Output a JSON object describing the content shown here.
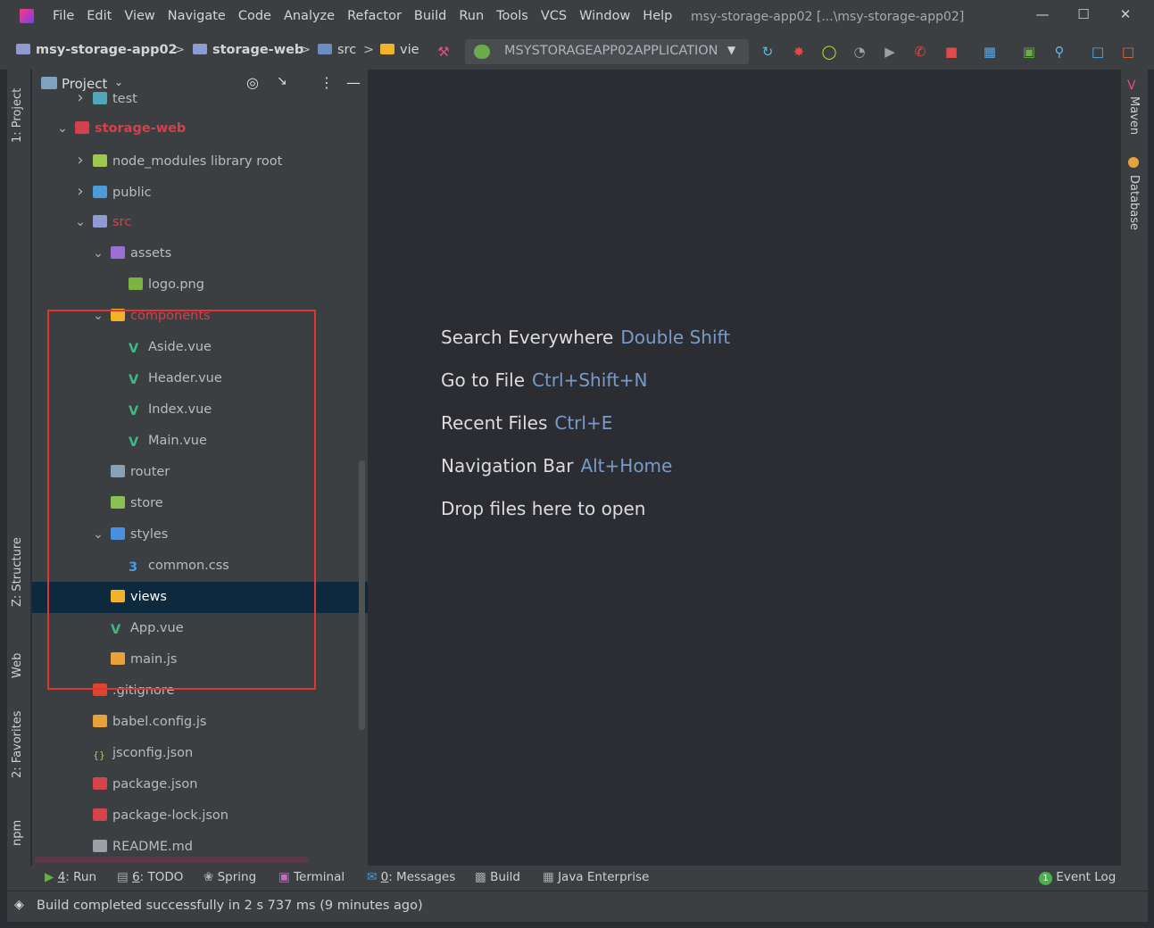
{
  "titlebar": {
    "menu": [
      "File",
      "Edit",
      "View",
      "Navigate",
      "Code",
      "Analyze",
      "Refactor",
      "Build",
      "Run",
      "Tools",
      "VCS",
      "Window",
      "Help"
    ],
    "title": "msy-storage-app02 [...\\msy-storage-app02]"
  },
  "navbar": {
    "crumbs": [
      "msy-storage-app02",
      "storage-web",
      "src",
      "vie"
    ],
    "run_config": "MSYSTORAGEAPP02APPLICATION"
  },
  "left_strip": {
    "tabs": [
      "1: Project",
      "Z: Structure",
      "Web",
      "2: Favorites",
      "npm"
    ]
  },
  "project": {
    "header": "Project",
    "tree": [
      {
        "label": "test",
        "indent": 1,
        "chev": ">",
        "icon": "folder-test",
        "color": "#50a6b8"
      },
      {
        "label": "storage-web",
        "indent": 0,
        "chev": "v",
        "icon": "folder-module",
        "color": "#d3404f",
        "bold": true
      },
      {
        "label": "node_modules  library root",
        "indent": 1,
        "chev": ">",
        "icon": "folder-lib",
        "color": "#9cc850"
      },
      {
        "label": "public",
        "indent": 1,
        "chev": ">",
        "icon": "folder-web",
        "color": "#4a9bd8"
      },
      {
        "label": "src",
        "indent": 1,
        "chev": "v",
        "icon": "folder-src",
        "color": "#8d9bd1",
        "red": true
      },
      {
        "label": "assets",
        "indent": 2,
        "chev": "v",
        "icon": "folder-assets",
        "color": "#9d6fd2"
      },
      {
        "label": "logo.png",
        "indent": 3,
        "chev": "",
        "icon": "image-file",
        "color": "#7cb342"
      },
      {
        "label": "components",
        "indent": 2,
        "chev": "v",
        "icon": "folder-components",
        "color": "#f2b32b",
        "red": true
      },
      {
        "label": "Aside.vue",
        "indent": 3,
        "chev": "",
        "icon": "vue-file",
        "color": "#41b883"
      },
      {
        "label": "Header.vue",
        "indent": 3,
        "chev": "",
        "icon": "vue-file",
        "color": "#41b883"
      },
      {
        "label": "Index.vue",
        "indent": 3,
        "chev": "",
        "icon": "vue-file",
        "color": "#41b883"
      },
      {
        "label": "Main.vue",
        "indent": 3,
        "chev": "",
        "icon": "vue-file",
        "color": "#41b883"
      },
      {
        "label": "router",
        "indent": 2,
        "chev": "",
        "icon": "folder-router",
        "color": "#8aa0b5"
      },
      {
        "label": "store",
        "indent": 2,
        "chev": "",
        "icon": "folder-store",
        "color": "#8cc04f"
      },
      {
        "label": "styles",
        "indent": 2,
        "chev": "v",
        "icon": "folder-styles",
        "color": "#4b8fe0"
      },
      {
        "label": "common.css",
        "indent": 3,
        "chev": "",
        "icon": "css-file",
        "color": "#4b9be8"
      },
      {
        "label": "views",
        "indent": 2,
        "chev": "",
        "icon": "folder-views",
        "color": "#f2b32b",
        "selected": true
      },
      {
        "label": "App.vue",
        "indent": 2,
        "chev": "",
        "icon": "vue-file",
        "color": "#41b883"
      },
      {
        "label": "main.js",
        "indent": 2,
        "chev": "",
        "icon": "js-file",
        "color": "#e8a23a"
      },
      {
        "label": ".gitignore",
        "indent": 1,
        "chev": "",
        "icon": "git-file",
        "color": "#e0442f"
      },
      {
        "label": "babel.config.js",
        "indent": 1,
        "chev": "",
        "icon": "js-file",
        "color": "#e8a23a"
      },
      {
        "label": "jsconfig.json",
        "indent": 1,
        "chev": "",
        "icon": "json-file",
        "color": "#c8b56c"
      },
      {
        "label": "package.json",
        "indent": 1,
        "chev": "",
        "icon": "npm-file",
        "color": "#d2444a"
      },
      {
        "label": "package-lock.json",
        "indent": 1,
        "chev": "",
        "icon": "lock-file",
        "color": "#d2444a"
      },
      {
        "label": "README.md",
        "indent": 1,
        "chev": "",
        "icon": "md-file",
        "color": "#9aa0a6"
      }
    ]
  },
  "editor": {
    "hints": [
      {
        "label": "Search Everywhere",
        "key": "Double Shift"
      },
      {
        "label": "Go to File",
        "key": "Ctrl+Shift+N"
      },
      {
        "label": "Recent Files",
        "key": "Ctrl+E"
      },
      {
        "label": "Navigation Bar",
        "key": "Alt+Home"
      },
      {
        "label": "Drop files here to open",
        "key": ""
      }
    ]
  },
  "right_strip": {
    "tabs": [
      "Maven",
      "Database"
    ]
  },
  "toolwindows": {
    "run": {
      "num": "4",
      "label": ": Run"
    },
    "todo": {
      "num": "6",
      "label": ": TODO"
    },
    "spring": "Spring",
    "terminal": "Terminal",
    "messages": {
      "num": "0",
      "label": ": Messages"
    },
    "build": "Build",
    "java_enterprise": "Java Enterprise",
    "event_log_count": "1",
    "event_log": "Event Log"
  },
  "status": {
    "message": "Build completed successfully in 2 s 737 ms (9 minutes ago)"
  },
  "colors": {
    "accent_red": "#e03535",
    "selection": "#0d293e",
    "module_red": "#d3404f"
  }
}
